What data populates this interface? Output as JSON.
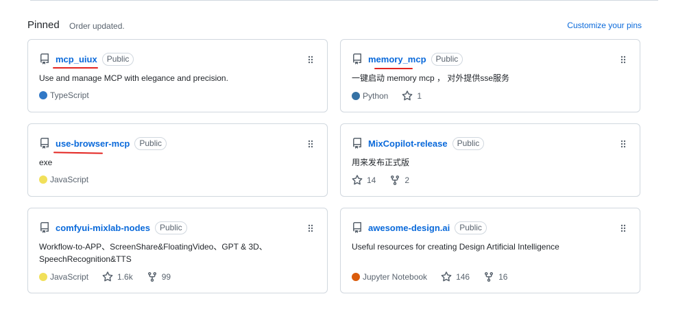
{
  "header": {
    "title": "Pinned",
    "order_note": "Order updated.",
    "customize_link": "Customize your pins"
  },
  "colors": {
    "link": "#0969da",
    "border": "#d0d7de",
    "muted": "#59636e",
    "annotation_underline": "#e3231f"
  },
  "cards": [
    {
      "name": "mcp_uiux",
      "visibility": "Public",
      "description": "Use and manage MCP with elegance and precision.",
      "language": "TypeScript",
      "language_color": "#3178c6",
      "stars": "",
      "forks": ""
    },
    {
      "name": "memory_mcp",
      "visibility": "Public",
      "description": "一键启动 memory mcp ， 对外提供sse服务",
      "language": "Python",
      "language_color": "#3572A5",
      "stars": "1",
      "forks": ""
    },
    {
      "name": "use-browser-mcp",
      "visibility": "Public",
      "description": "exe",
      "language": "JavaScript",
      "language_color": "#f1e05a",
      "stars": "",
      "forks": ""
    },
    {
      "name": "MixCopilot-release",
      "visibility": "Public",
      "description": "用来发布正式版",
      "language": "",
      "language_color": "",
      "stars": "14",
      "forks": "2"
    },
    {
      "name": "comfyui-mixlab-nodes",
      "visibility": "Public",
      "description": "Workflow-to-APP、ScreenShare&FloatingVideo、GPT & 3D、SpeechRecognition&TTS",
      "language": "JavaScript",
      "language_color": "#f1e05a",
      "stars": "1.6k",
      "forks": "99"
    },
    {
      "name": "awesome-design.ai",
      "visibility": "Public",
      "description": "Useful resources for creating Design Artificial Intelligence",
      "language": "Jupyter Notebook",
      "language_color": "#DA5B0B",
      "stars": "146",
      "forks": "16"
    }
  ]
}
